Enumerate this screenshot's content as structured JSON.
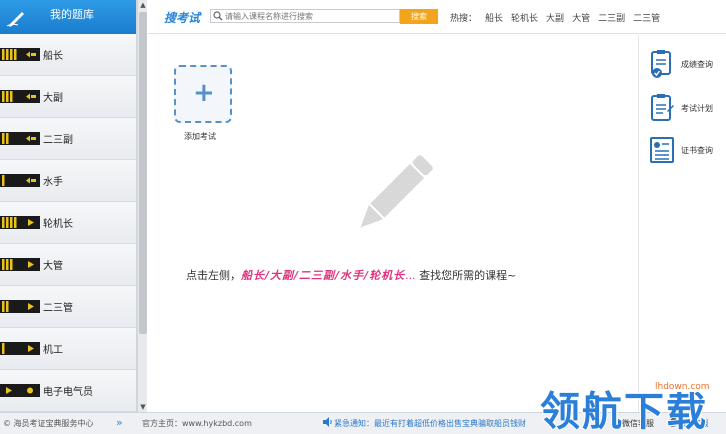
{
  "sidebar": {
    "title": "我的题库",
    "items": [
      {
        "label": "船长",
        "stripes": 4,
        "bars": 1
      },
      {
        "label": "大副",
        "stripes": 3,
        "bars": 1
      },
      {
        "label": "二三副",
        "stripes": 2,
        "bars": 1
      },
      {
        "label": "水手",
        "stripes": 1,
        "bars": 1
      },
      {
        "label": "轮机长",
        "stripes": 4,
        "bars": 2
      },
      {
        "label": "大管",
        "stripes": 3,
        "bars": 2
      },
      {
        "label": "二三管",
        "stripes": 2,
        "bars": 2
      },
      {
        "label": "机工",
        "stripes": 1,
        "bars": 2
      },
      {
        "label": "电子电气员",
        "stripes": 0,
        "bars": 3
      }
    ]
  },
  "topbar": {
    "brand": "搜考试",
    "search_placeholder": "请输入课程名称进行搜索",
    "search_button": "搜索",
    "hot_label": "热搜：",
    "hot_items": [
      "船长",
      "轮机长",
      "大副",
      "大管",
      "二三副",
      "二三管"
    ]
  },
  "main": {
    "add_label": "添加考试",
    "hint_prefix": "点击左侧，",
    "hint_courses": "船长/大副/二三副/水手/轮机长",
    "hint_dots": "...",
    "hint_suffix": "  查找您所需的课程~"
  },
  "rightpanel": {
    "items": [
      {
        "label": "成绩查询",
        "icon": "score-query-icon"
      },
      {
        "label": "考试计划",
        "icon": "exam-plan-icon"
      },
      {
        "label": "证书查询",
        "icon": "certificate-query-icon"
      }
    ]
  },
  "statusbar": {
    "copyright": "© 海员考证宝典服务中心",
    "site": "官方主页：www.hykzbd.com",
    "notice": "紧急通知：最近有打着超低价格出售宝典骗取船员钱财",
    "right1": "微信客服",
    "right2": "QQ客服"
  },
  "watermark": {
    "text": "领航下载",
    "site": "lhdown.com"
  },
  "colors": {
    "accent": "#2a86d6",
    "hot_pink": "#e0337f",
    "search_button": "#f3a41a",
    "rank_gold": "#e9c21a"
  }
}
